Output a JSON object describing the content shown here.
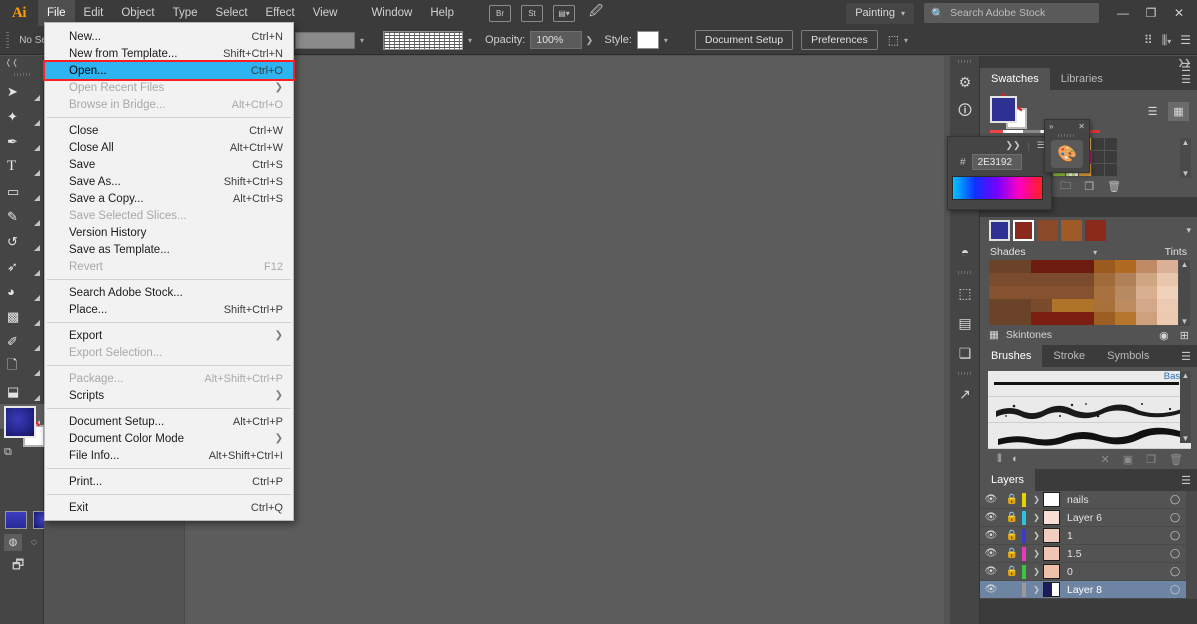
{
  "app": {
    "logo": "Ai",
    "menus": [
      "File",
      "Edit",
      "Object",
      "Type",
      "Select",
      "Effect",
      "View"
    ],
    "menus_right": [
      "Window",
      "Help"
    ],
    "workspace": "Painting",
    "search_placeholder": "Search Adobe Stock",
    "window_buttons": {
      "minimize": "—",
      "restore": "❐",
      "close": "✕"
    },
    "header_icons": [
      "bridge-icon",
      "stock-icon",
      "arrange-documents-icon"
    ]
  },
  "control_bar": {
    "selection_status": "No Sele",
    "opacity_label": "Opacity:",
    "opacity_value": "100%",
    "style_label": "Style:",
    "document_setup": "Document Setup",
    "preferences": "Preferences",
    "fill_color": "#8a8a8a"
  },
  "file_menu": {
    "items": [
      {
        "label": "New...",
        "shortcut": "Ctrl+N",
        "state": "normal"
      },
      {
        "label": "New from Template...",
        "shortcut": "Shift+Ctrl+N",
        "state": "normal"
      },
      {
        "label": "Open...",
        "shortcut": "Ctrl+O",
        "state": "highlight"
      },
      {
        "label": "Open Recent Files",
        "shortcut": "",
        "state": "disabled",
        "submenu": true
      },
      {
        "label": "Browse in Bridge...",
        "shortcut": "Alt+Ctrl+O",
        "state": "disabled"
      },
      {
        "separator": true
      },
      {
        "label": "Close",
        "shortcut": "Ctrl+W",
        "state": "normal"
      },
      {
        "label": "Close All",
        "shortcut": "Alt+Ctrl+W",
        "state": "normal"
      },
      {
        "label": "Save",
        "shortcut": "Ctrl+S",
        "state": "normal"
      },
      {
        "label": "Save As...",
        "shortcut": "Shift+Ctrl+S",
        "state": "normal"
      },
      {
        "label": "Save a Copy...",
        "shortcut": "Alt+Ctrl+S",
        "state": "normal"
      },
      {
        "label": "Save Selected Slices...",
        "shortcut": "",
        "state": "disabled"
      },
      {
        "label": "Version History",
        "shortcut": "",
        "state": "normal"
      },
      {
        "label": "Save as Template...",
        "shortcut": "",
        "state": "normal"
      },
      {
        "label": "Revert",
        "shortcut": "F12",
        "state": "disabled"
      },
      {
        "separator": true
      },
      {
        "label": "Search Adobe Stock...",
        "shortcut": "",
        "state": "normal"
      },
      {
        "label": "Place...",
        "shortcut": "Shift+Ctrl+P",
        "state": "normal"
      },
      {
        "separator": true
      },
      {
        "label": "Export",
        "shortcut": "",
        "state": "normal",
        "submenu": true
      },
      {
        "label": "Export Selection...",
        "shortcut": "",
        "state": "disabled"
      },
      {
        "separator": true
      },
      {
        "label": "Package...",
        "shortcut": "Alt+Shift+Ctrl+P",
        "state": "disabled"
      },
      {
        "label": "Scripts",
        "shortcut": "",
        "state": "normal",
        "submenu": true
      },
      {
        "separator": true
      },
      {
        "label": "Document Setup...",
        "shortcut": "Alt+Ctrl+P",
        "state": "normal"
      },
      {
        "label": "Document Color Mode",
        "shortcut": "",
        "state": "normal",
        "submenu": true
      },
      {
        "label": "File Info...",
        "shortcut": "Alt+Shift+Ctrl+I",
        "state": "normal"
      },
      {
        "separator": true
      },
      {
        "label": "Print...",
        "shortcut": "Ctrl+P",
        "state": "normal"
      },
      {
        "separator": true
      },
      {
        "label": "Exit",
        "shortcut": "Ctrl+Q",
        "state": "normal"
      }
    ],
    "highlight_outline_color": "#ff1f1f",
    "highlight_color": "#2eb4f0"
  },
  "toolbar": {
    "tools": [
      {
        "name": "selection-tool",
        "glyph": "➤"
      },
      {
        "name": "magic-wand-tool",
        "glyph": "✦"
      },
      {
        "name": "pen-tool",
        "glyph": "✒"
      },
      {
        "name": "type-tool",
        "glyph": "T"
      },
      {
        "name": "rectangle-tool",
        "glyph": "■"
      },
      {
        "name": "paintbrush-tool",
        "glyph": "✐"
      },
      {
        "name": "rotate-tool",
        "glyph": "↺"
      },
      {
        "name": "width-tool",
        "glyph": "∿"
      },
      {
        "name": "shape-builder-tool",
        "glyph": "◔"
      },
      {
        "name": "mesh-tool",
        "glyph": "⌗"
      },
      {
        "name": "eyedropper-tool",
        "glyph": "✑"
      },
      {
        "name": "symbol-sprayer-tool",
        "glyph": "☃"
      },
      {
        "name": "artboard-tool",
        "glyph": "⬚"
      },
      {
        "name": "hand-tool",
        "glyph": "✋"
      }
    ],
    "fill_color": "#2e3192",
    "stroke_color": "#ffffff"
  },
  "swatches_panel": {
    "tabs": [
      "Swatches",
      "Libraries"
    ],
    "active_tab": "Swatches",
    "fill_color": "#2e3192",
    "colors": [
      "#00bcd0",
      "#1b28d0",
      "#ee2cc0",
      "#c44040",
      "#e03030",
      "#e06a28",
      "#e8a038",
      "#e8b048",
      "#00b09a",
      "#49bde8",
      "#1e8fd8",
      "#3a48b8",
      "#2a2a78",
      "#7a3ab0",
      "#a050c0",
      "#b01868",
      "#b07a4a",
      "#a86a3a",
      "#8a5028",
      "#6a3a18",
      "#efefef",
      "#8ec63f",
      "#e8a038"
    ]
  },
  "color_picker_float": {
    "hex_prefix": "#",
    "hex_value": "2E3192"
  },
  "palette_float": {
    "icon": "artist-palette-icon",
    "collapse": "»",
    "close": "✕"
  },
  "color_guide_panel": {
    "shades_label": "Shades",
    "tints_label": "Tints",
    "footer_label": "Skintones",
    "base_color": "#2e3192",
    "active_color": "#8b2a1c",
    "harmony_colors": [
      "#8a4a2a",
      "#a05a28",
      "#8a2a1a"
    ],
    "grid": [
      [
        "#6b4328",
        "#6b4328",
        "#6e1c10",
        "#6e1c10",
        "#6e1c10",
        "#9a5a20",
        "#b06a22",
        "#c08a64",
        "#dcb096"
      ],
      [
        "#7a4c2d",
        "#7a4c2d",
        "#7a4c2d",
        "#7a4c2d",
        "#7a4c2d",
        "#a06a3a",
        "#b08058",
        "#d0a582",
        "#e8c7ad"
      ],
      [
        "#85512f",
        "#85512f",
        "#85512f",
        "#85512f",
        "#85512f",
        "#a87240",
        "#b88a62",
        "#d8b090",
        "#f0d2bb"
      ],
      [
        "#6b4328",
        "#6b4328",
        "#7a4c2d",
        "#b07428",
        "#b07428",
        "#a8703a",
        "#bc8c60",
        "#d2a888",
        "#eccbb2"
      ],
      [
        "#6b4328",
        "#6b4328",
        "#7b1d10",
        "#7b1d10",
        "#7b1d10",
        "#9c5e22",
        "#b6762e",
        "#cfa07c",
        "#ecc9af"
      ]
    ]
  },
  "brushes_panel": {
    "tabs": [
      "Brushes",
      "Stroke",
      "Symbols"
    ],
    "active_tab": "Brushes",
    "group_label": "Basic",
    "brushes": [
      "basic-stroke",
      "charcoal-rough-brush",
      "dry-ink-brush"
    ]
  },
  "layers_panel": {
    "tabs": [
      "Layers"
    ],
    "active_tab": "Layers",
    "rows": [
      {
        "name": "nails",
        "color": "#e8d200",
        "thumb": "#ffffff",
        "selected": false,
        "locked": true
      },
      {
        "name": "Layer 6",
        "color": "#2bc4e0",
        "thumb": "#f7ded6",
        "selected": false,
        "locked": true
      },
      {
        "name": "1",
        "color": "#3a3ad0",
        "thumb": "#f0cec0",
        "selected": false,
        "locked": true
      },
      {
        "name": "1.5",
        "color": "#e838c0",
        "thumb": "#efc6b4",
        "selected": false,
        "locked": true
      },
      {
        "name": "0",
        "color": "#3ec43e",
        "thumb": "#efc0aa",
        "selected": false,
        "locked": true
      },
      {
        "name": "Layer 8",
        "color": "#9a9a9a",
        "thumb": "#1b1b5e",
        "selected": true,
        "locked": false
      }
    ]
  },
  "right_rail": {
    "icons": [
      "gear-icon",
      "info-icon",
      "appearance-icon",
      "transform-icon",
      "align-icon",
      "pathfinder-icon",
      "export-icon"
    ]
  }
}
